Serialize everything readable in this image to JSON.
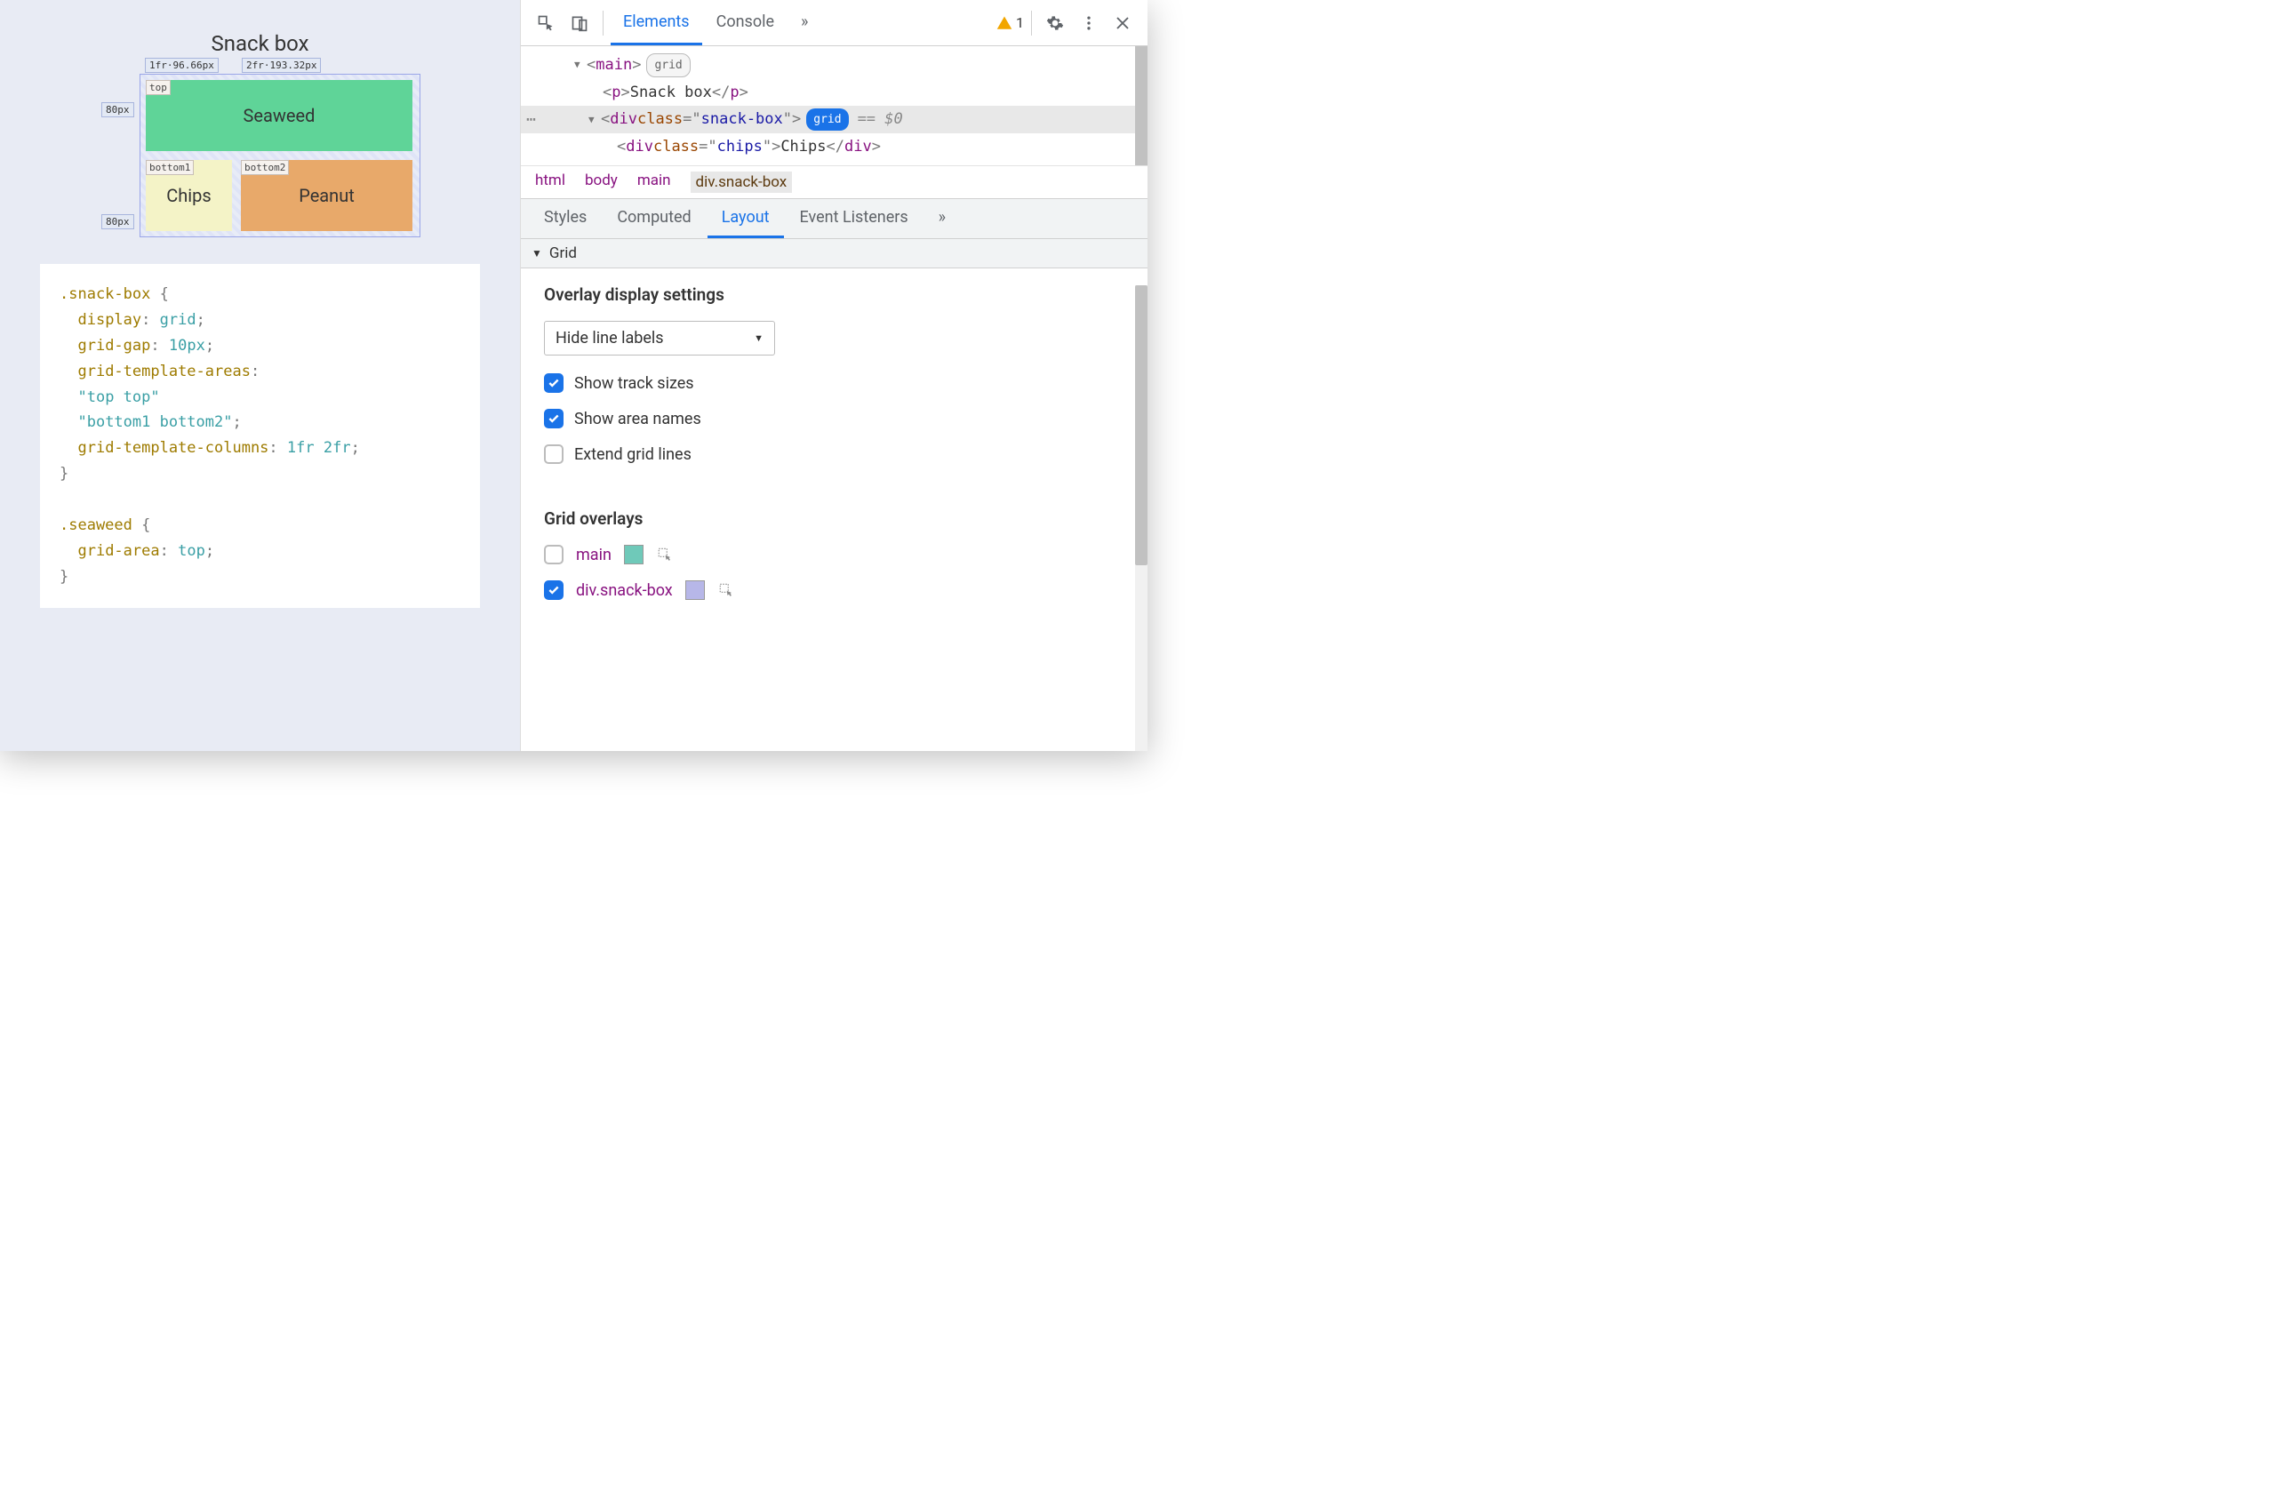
{
  "preview": {
    "title": "Snack box",
    "cells": {
      "seaweed": "Seaweed",
      "chips": "Chips",
      "peanut": "Peanut"
    },
    "area_labels": {
      "top": "top",
      "bottom1": "bottom1",
      "bottom2": "bottom2"
    },
    "track_labels": {
      "row1": "80px",
      "row2": "80px",
      "col1": "1fr·96.66px",
      "col2": "2fr·193.32px"
    }
  },
  "code": ".snack-box {\n  display: grid;\n  grid-gap: 10px;\n  grid-template-areas:\n  \"top top\"\n  \"bottom1 bottom2\";\n  grid-template-columns: 1fr 2fr;\n}\n\n.seaweed {\n  grid-area: top;\n}",
  "toolbar": {
    "tabs": {
      "elements": "Elements",
      "console": "Console"
    },
    "more": "»",
    "warnings": "1"
  },
  "dom": {
    "line1": {
      "tag": "main",
      "pill": "grid"
    },
    "line2": {
      "tag": "p",
      "text": "Snack box"
    },
    "line3": {
      "tag": "div",
      "class_name": "class",
      "class_val": "snack-box",
      "pill": "grid",
      "suffix": "== $0"
    },
    "line4": {
      "tag": "div",
      "class_name": "class",
      "class_val": "chips",
      "text": "Chips"
    }
  },
  "breadcrumb": {
    "items": [
      "html",
      "body",
      "main",
      "div.snack-box"
    ]
  },
  "subtabs": {
    "styles": "Styles",
    "computed": "Computed",
    "layout": "Layout",
    "listeners": "Event Listeners",
    "more": "»"
  },
  "grid_section": {
    "header": "Grid",
    "overlay_title": "Overlay display settings",
    "dropdown": "Hide line labels",
    "opts": {
      "track_sizes": "Show track sizes",
      "area_names": "Show area names",
      "extend": "Extend grid lines"
    },
    "overlays_title": "Grid overlays",
    "overlays": {
      "main": "main",
      "snack": "div.snack-box"
    },
    "colors": {
      "main": "#6fc9b9",
      "snack": "#b7b7e8"
    }
  }
}
